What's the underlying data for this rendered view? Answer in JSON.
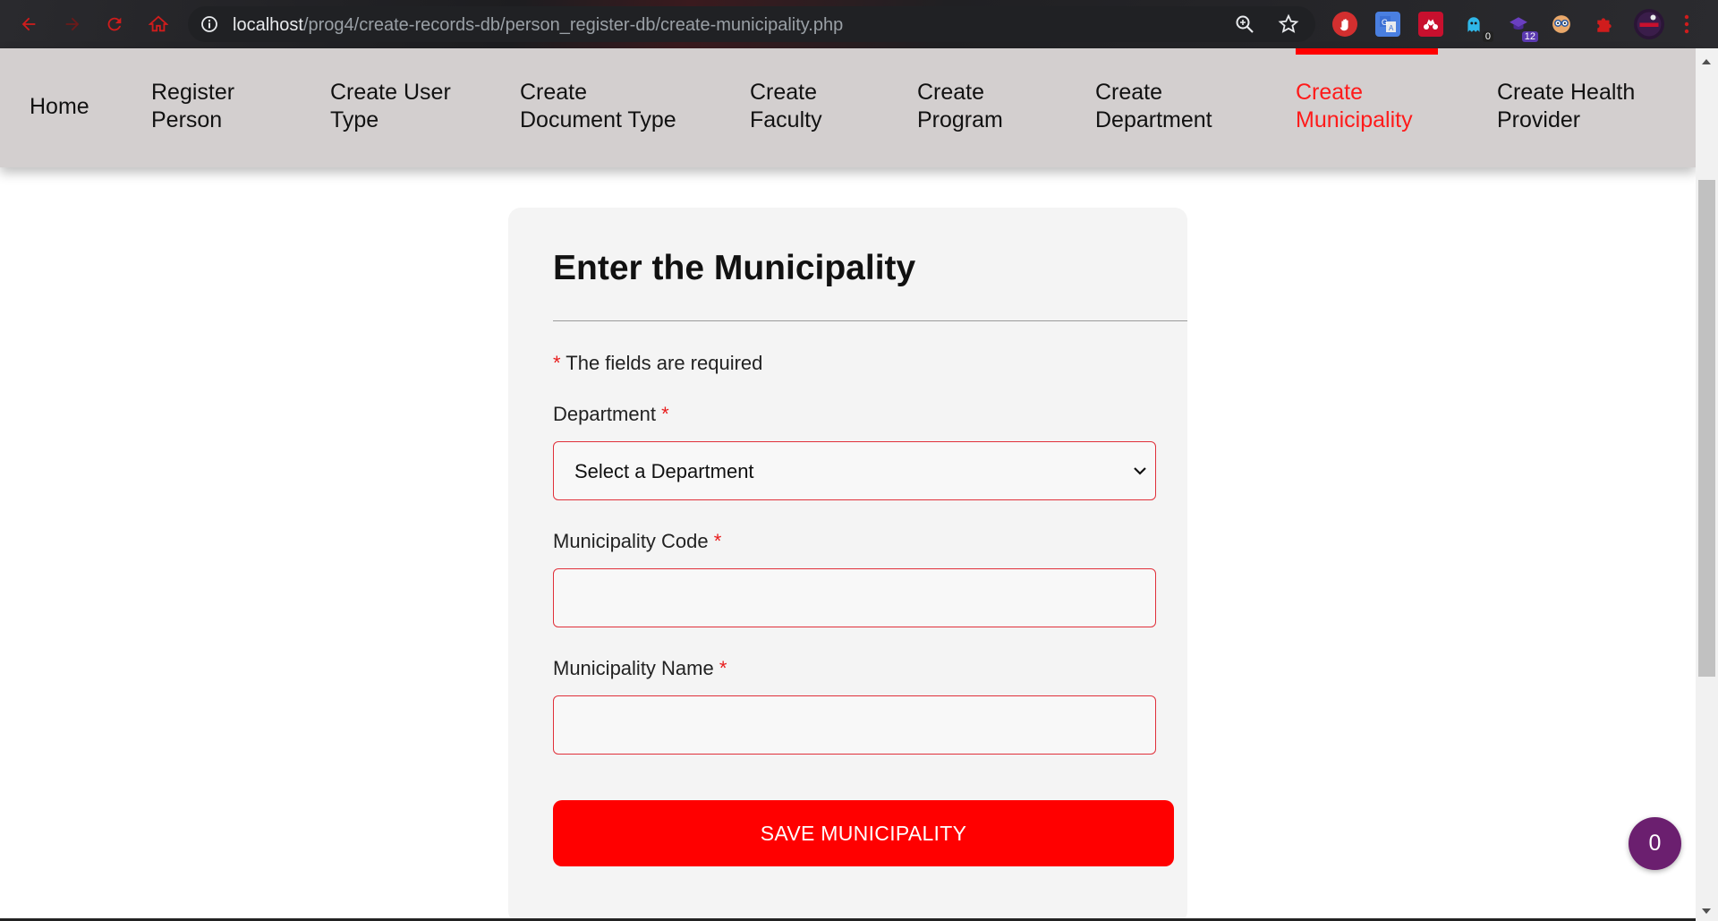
{
  "browser": {
    "url_host": "localhost",
    "url_path": "/prog4/create-records-db/person_register-db/create-municipality.php",
    "extensions": [
      {
        "icon": "adblock-icon",
        "badge": ""
      },
      {
        "icon": "google-translate-icon",
        "badge": ""
      },
      {
        "icon": "mendeley-icon",
        "badge": ""
      },
      {
        "icon": "ghost-icon",
        "badge": "0"
      },
      {
        "icon": "graduation-cap-icon",
        "badge": "12"
      },
      {
        "icon": "glasses-face-icon",
        "badge": ""
      },
      {
        "icon": "puzzle-extensions-icon",
        "badge": ""
      },
      {
        "icon": "profile-avatar-icon",
        "badge": ""
      }
    ]
  },
  "nav": {
    "items": [
      {
        "line1": "Home",
        "line2": ""
      },
      {
        "line1": "Register",
        "line2": "Person"
      },
      {
        "line1": "Create User",
        "line2": "Type"
      },
      {
        "line1": "Create",
        "line2": "Document Type"
      },
      {
        "line1": "Create",
        "line2": "Faculty"
      },
      {
        "line1": "Create",
        "line2": "Program"
      },
      {
        "line1": "Create",
        "line2": "Department"
      },
      {
        "line1": "Create",
        "line2": "Municipality"
      },
      {
        "line1": "Create Health",
        "line2": "Provider"
      }
    ],
    "active_index": 7,
    "active_color": "#ff1a1a"
  },
  "form": {
    "title": "Enter the Municipality",
    "required_asterisk": "*",
    "required_note": "The fields are required",
    "department_label": "Department",
    "department_selected": "Select a Department",
    "code_label": "Municipality Code",
    "code_value": "",
    "name_label": "Municipality Name",
    "name_value": "",
    "save_label": "SAVE MUNICIPALITY"
  },
  "floating_counter": "0",
  "colors": {
    "accent": "#ff0000",
    "nav_bg": "#d3cfcf",
    "card_bg": "#f4f4f4",
    "counter_bg": "#6b1f6f"
  }
}
